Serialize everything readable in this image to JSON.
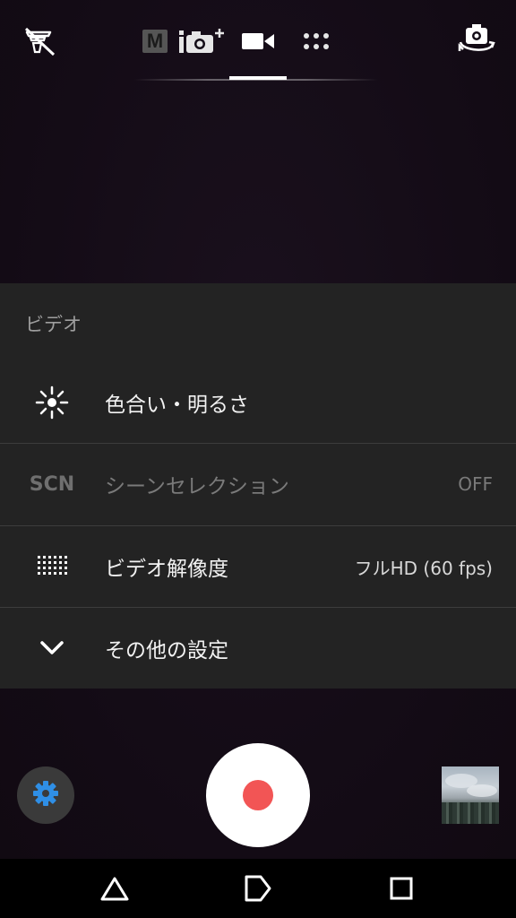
{
  "top_bar": {
    "icons": {
      "flash": "flash-off-icon",
      "manual_mode": "manual-mode-icon",
      "auto_mode": "superior-auto-icon",
      "video_mode": "video-camera-icon",
      "apps_mode": "camera-apps-grid-icon",
      "switch_camera": "switch-camera-icon"
    },
    "manual_mode_letter": "M",
    "active_mode": "video"
  },
  "settings_panel": {
    "title": "ビデオ",
    "rows": [
      {
        "icon": "brightness-icon",
        "label": "色合い・明るさ",
        "value": "",
        "enabled": true
      },
      {
        "icon_text": "SCN",
        "label": "シーンセレクション",
        "value": "OFF",
        "enabled": false
      },
      {
        "icon": "resolution-grid-icon",
        "label": "ビデオ解像度",
        "value": "フルHD (60 fps)",
        "enabled": true
      },
      {
        "icon": "chevron-down-icon",
        "label": "その他の設定",
        "value": "",
        "enabled": true
      }
    ]
  },
  "bottom_controls": {
    "settings_icon": "gear-icon",
    "shutter": "record-button",
    "thumbnail": "last-photo-thumbnail"
  },
  "nav_bar": {
    "back": "back-triangle-icon",
    "home": "home-icon",
    "recent": "recent-apps-icon"
  },
  "colors": {
    "background": "#140d17",
    "panel": "#232323",
    "record": "#f25555",
    "gear_accent": "#2f8fe6"
  }
}
